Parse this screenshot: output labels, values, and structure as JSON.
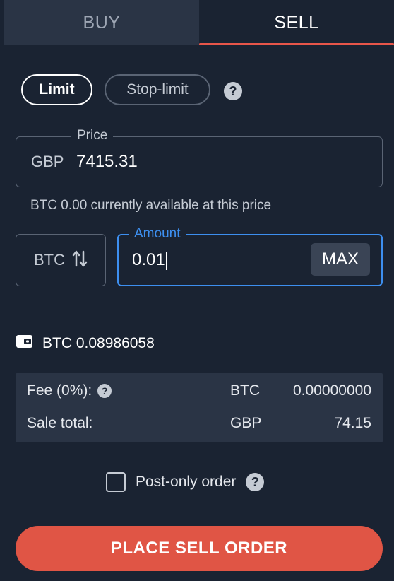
{
  "tabs": {
    "buy": "BUY",
    "sell": "SELL",
    "active": "sell"
  },
  "order_types": {
    "limit": "Limit",
    "stop_limit": "Stop-limit",
    "selected": "limit"
  },
  "price": {
    "legend": "Price",
    "currency": "GBP",
    "value": "7415.31"
  },
  "availability_note": "BTC 0.00 currently available at this price",
  "amount": {
    "legend": "Amount",
    "currency_toggle": "BTC",
    "value": "0.01",
    "max_label": "MAX"
  },
  "wallet": {
    "balance": "BTC 0.08986058"
  },
  "summary": {
    "fee_label": "Fee (0%):",
    "fee_currency": "BTC",
    "fee_amount": "0.00000000",
    "total_label": "Sale total:",
    "total_currency": "GBP",
    "total_amount": "74.15"
  },
  "post_only": {
    "label": "Post-only order",
    "checked": false
  },
  "place_button": "PLACE SELL ORDER",
  "help_glyph": "?",
  "colors": {
    "accent": "#e05545",
    "focus": "#3d8ff0",
    "background": "#1a2332",
    "panel": "#2a3445"
  },
  "icons": {
    "swap": "swap-vertical-icon",
    "wallet": "wallet-icon",
    "help": "question-circle-icon"
  }
}
